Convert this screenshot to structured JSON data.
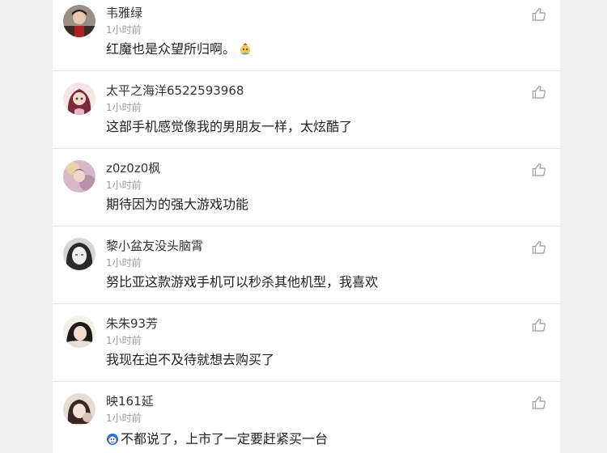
{
  "comments": [
    {
      "user": "韦雅绿",
      "time": "1小时前",
      "text": "红魔也是众望所归啊。",
      "emoji": "party-emoji-icon"
    },
    {
      "user": "太平之海洋6522593968",
      "time": "1小时前",
      "text": "这部手机感觉像我的男朋友一样，太炫酷了"
    },
    {
      "user": "z0z0z0枫",
      "time": "1小时前",
      "text": "期待因为的强大游戏功能"
    },
    {
      "user": "黎小盆友没头脑霄",
      "time": "1小时前",
      "text": "努比亚这款游戏手机可以秒杀其他机型，我喜欢"
    },
    {
      "user": "朱朱93芳",
      "time": "1小时前",
      "text": "我现在迫不及待就想去购买了"
    },
    {
      "user": "映161延",
      "time": "1小时前",
      "text": "不都说了，上市了一定要赶紧买一台",
      "emoji": "blue-face-emoji-icon"
    }
  ],
  "colors": {
    "background": "#f1f1f1",
    "panel": "#ffffff",
    "divider": "#e4e4e4",
    "muted": "#999999"
  }
}
